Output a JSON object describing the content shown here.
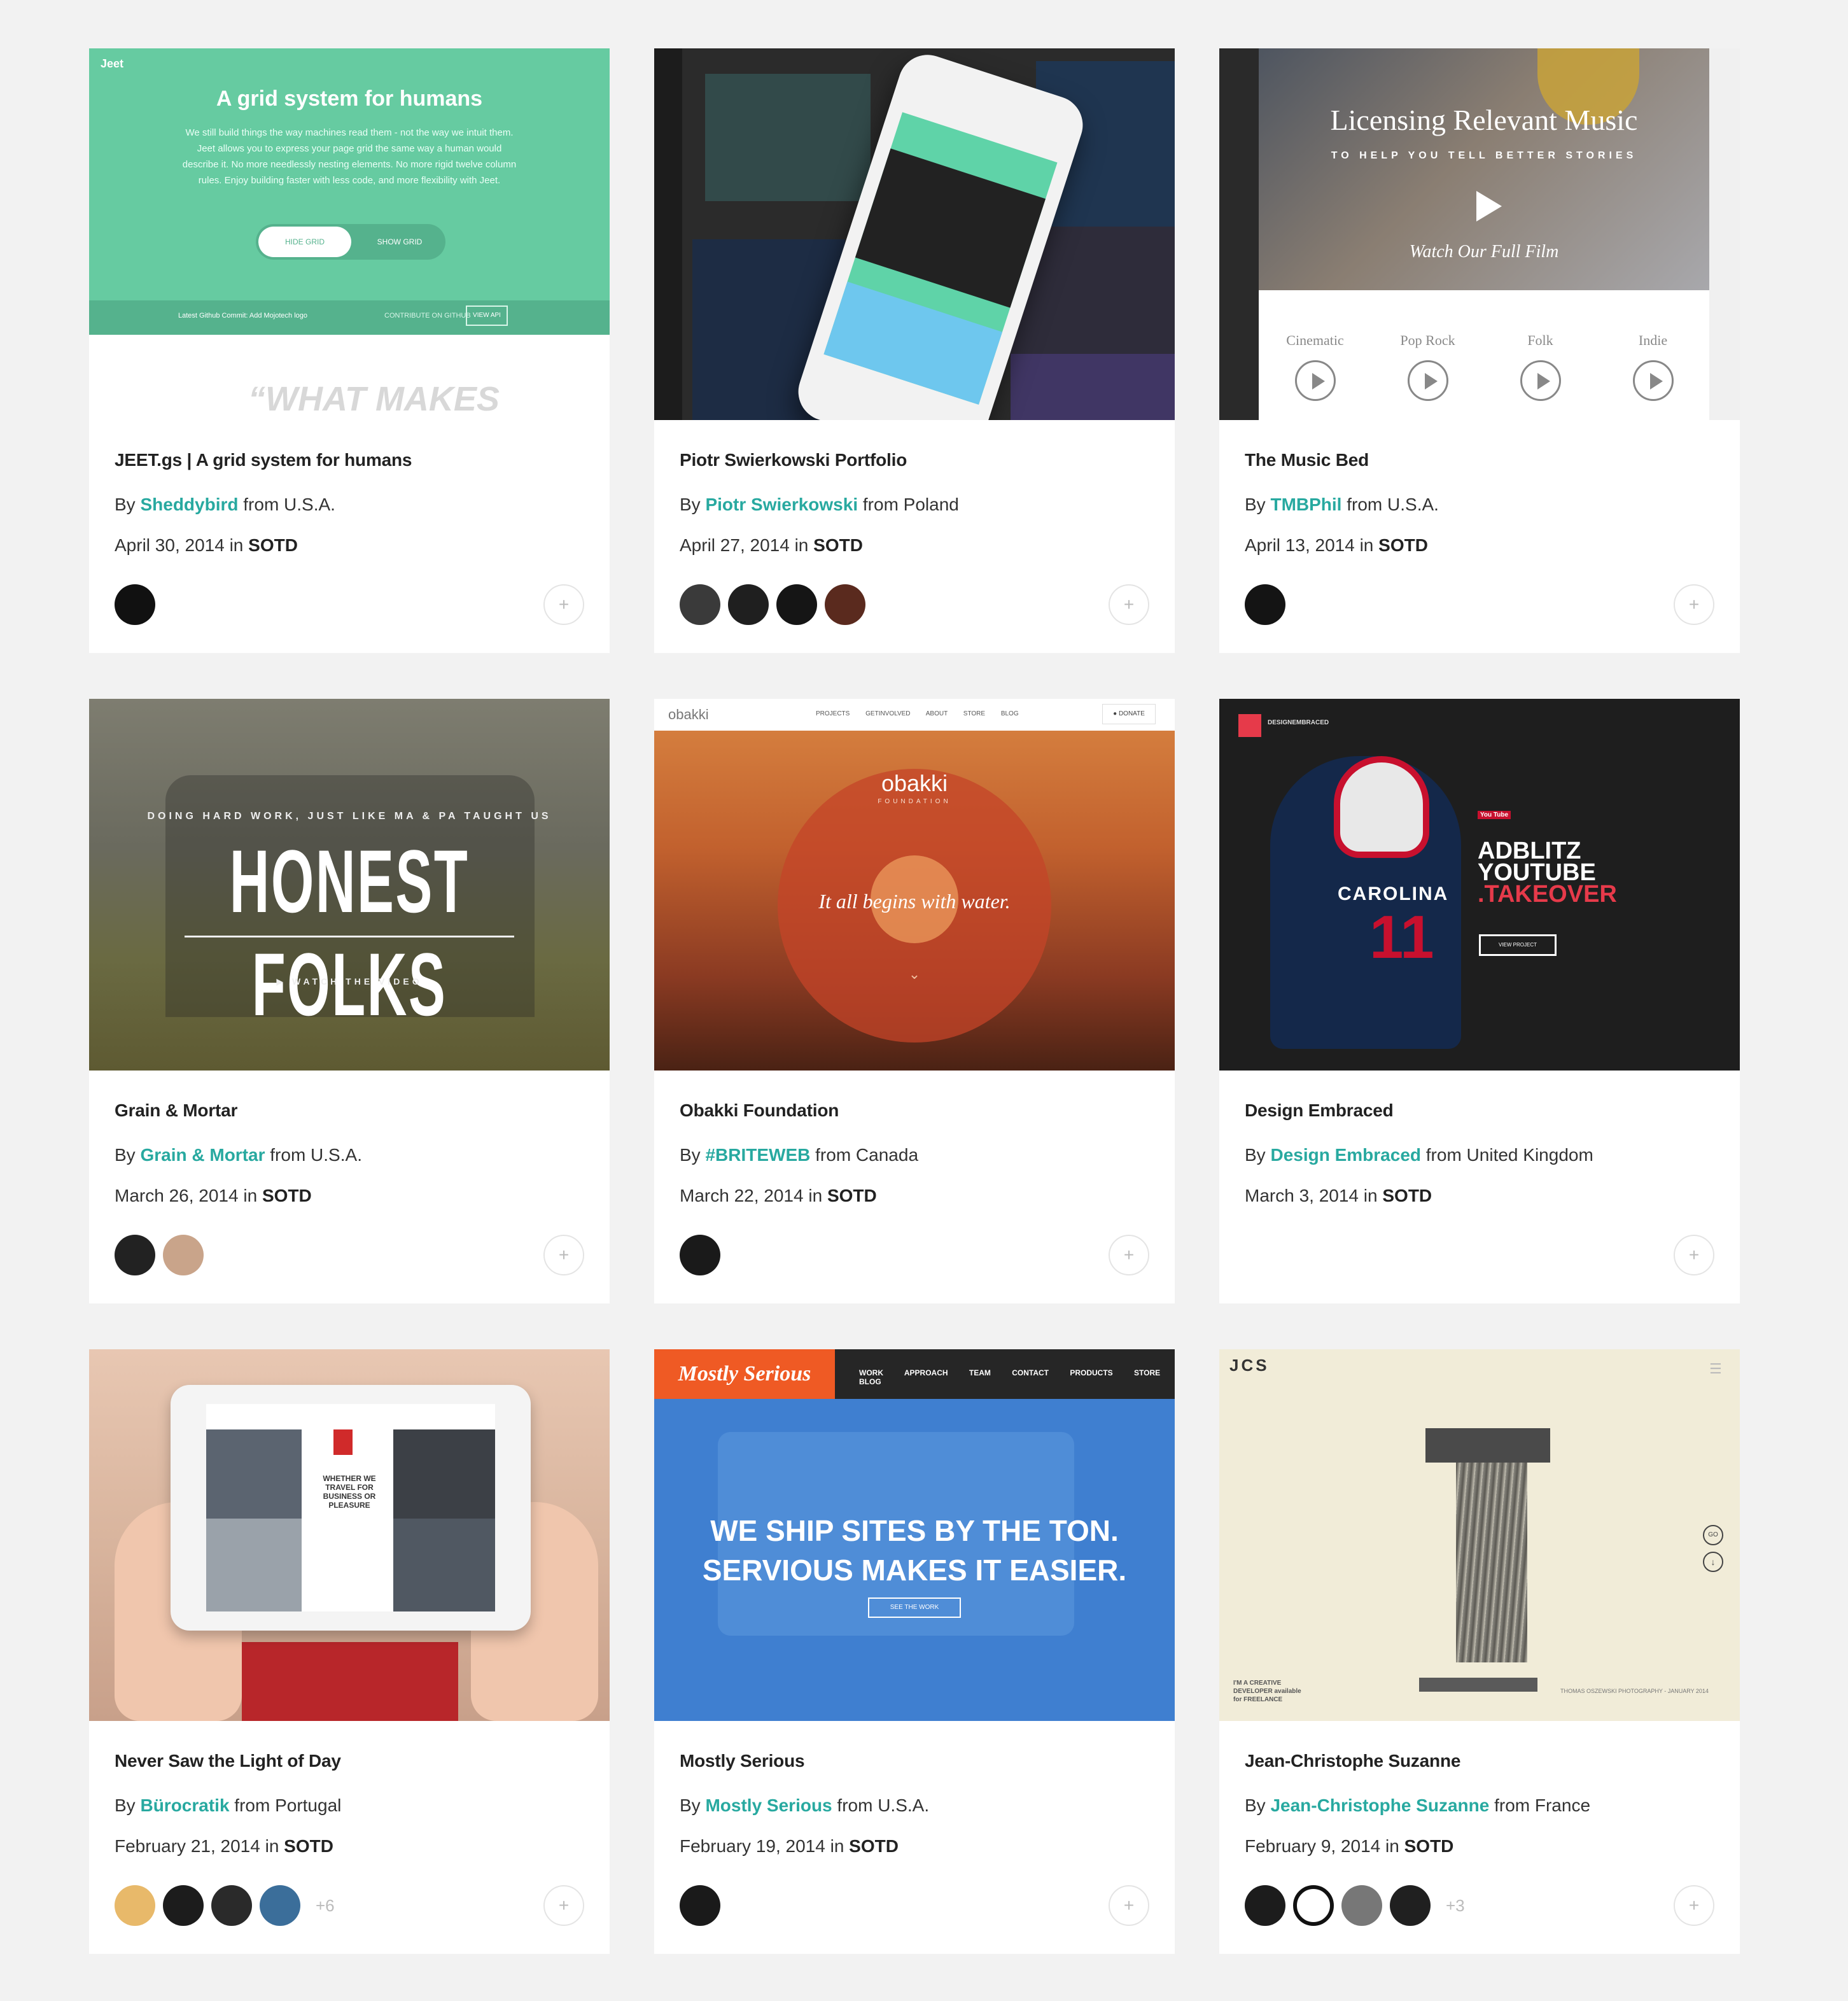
{
  "cards": [
    {
      "title": "JEET.gs | A grid system for humans",
      "by_prefix": "By",
      "author": "Sheddybird",
      "from": "from U.S.A.",
      "date": "April 30, 2014",
      "in_word": "in",
      "category": "SOTD",
      "avatars": [
        "#111111"
      ],
      "more": "",
      "thumb": {
        "logo": "Jeet",
        "heading": "A grid system for humans",
        "body": "We still build things the way machines read them - not the way we intuit them. Jeet allows you to express your page grid the same way a human would describe it. No more needlessly nesting elements. No more rigid twelve column rules. Enjoy building faster with less code, and more flexibility with Jeet.",
        "hide_grid": "HIDE GRID",
        "show_grid": "SHOW GRID",
        "commit": "Latest Github Commit: Add Mojotech logo",
        "contribute": "CONTRIBUTE ON GITHUB",
        "view_api": "VIEW API",
        "quote": "“WHAT MAKES"
      }
    },
    {
      "title": "Piotr Swierkowski Portfolio",
      "by_prefix": "By",
      "author": "Piotr Swierkowski",
      "from": "from Poland",
      "date": "April 27, 2014",
      "in_word": "in",
      "category": "SOTD",
      "avatars": [
        "#3a3a3a",
        "#1f1f1f",
        "#151515",
        "#5a2a1e"
      ],
      "more": ""
    },
    {
      "title": "The Music Bed",
      "by_prefix": "By",
      "author": "TMBPhil",
      "from": "from U.S.A.",
      "date": "April 13, 2014",
      "in_word": "in",
      "category": "SOTD",
      "avatars": [
        "#141414"
      ],
      "more": "",
      "thumb": {
        "heading": "Licensing Relevant Music",
        "sub": "TO HELP YOU TELL BETTER STORIES",
        "film": "Watch Our Full Film",
        "genres": [
          "Cinematic",
          "Pop Rock",
          "Folk",
          "Indie"
        ]
      }
    },
    {
      "title": "Grain & Mortar",
      "by_prefix": "By",
      "author": "Grain & Mortar",
      "from": "from U.S.A.",
      "date": "March 26, 2014",
      "in_word": "in",
      "category": "SOTD",
      "avatars": [
        "#222222",
        "#c9a48a"
      ],
      "more": "",
      "thumb": {
        "tag": "DOING HARD WORK, JUST LIKE MA & PA TAUGHT US",
        "big": "HONEST FOLKS",
        "watch": "▶ WATCH THE VIDEO"
      }
    },
    {
      "title": "Obakki Foundation",
      "by_prefix": "By",
      "author": "#BRITEWEB",
      "from": "from Canada",
      "date": "March 22, 2014",
      "in_word": "in",
      "category": "SOTD",
      "avatars": [
        "#1a1a1a"
      ],
      "more": "",
      "thumb": {
        "logo": "obakki",
        "nav": "PROJECTS GETINVOLVED ABOUT STORE BLOG",
        "donate": "● DONATE",
        "name": "obakki",
        "foundation": "FOUNDATION",
        "tagline": "It all begins with water.",
        "chevron": "⌄"
      }
    },
    {
      "title": "Design Embraced",
      "by_prefix": "By",
      "author": "Design Embraced",
      "from": "from United Kingdom",
      "date": "March 3, 2014",
      "in_word": "in",
      "category": "SOTD",
      "avatars": [],
      "more": "",
      "thumb": {
        "logo_text": "DESIGNEMBRACED",
        "team": "CAROLINA",
        "number": "11",
        "yt": "You Tube",
        "ad1": "ADBLITZ",
        "ad2": "YOUTUBE",
        "ad3": ".TAKEOVER",
        "btn": "VIEW PROJECT"
      }
    },
    {
      "title": "Never Saw the Light of Day",
      "by_prefix": "By",
      "author": "Bürocratik",
      "from": "from Portugal",
      "date": "February 21, 2014",
      "in_word": "in",
      "category": "SOTD",
      "avatars": [
        "#e8b96a",
        "#1c1c1c",
        "#2a2a2a",
        "#3b6e9a"
      ],
      "more": "+6",
      "thumb": {
        "text": "WHETHER WE TRAVEL FOR BUSINESS OR PLEASURE"
      }
    },
    {
      "title": "Mostly Serious",
      "by_prefix": "By",
      "author": "Mostly Serious",
      "from": "from U.S.A.",
      "date": "February 19, 2014",
      "in_word": "in",
      "category": "SOTD",
      "avatars": [
        "#1a1a1a"
      ],
      "more": "",
      "thumb": {
        "logo": "Mostly Serious",
        "nav": "WORK APPROACH TEAM CONTACT PRODUCTS STORE BLOG",
        "line1": "WE SHIP SITES BY THE TON.",
        "line2": "SERVIOUS MAKES IT EASIER.",
        "btn": "SEE THE WORK"
      }
    },
    {
      "title": "Jean-Christophe Suzanne",
      "by_prefix": "By",
      "author": "Jean-Christophe Suzanne",
      "from": "from France",
      "date": "February 9, 2014",
      "in_word": "in",
      "category": "SOTD",
      "avatars": [
        "#1c1c1c",
        "#ffffff",
        "#777777",
        "#202020"
      ],
      "more": "+3",
      "thumb": {
        "logo": "JCS",
        "go": "GO",
        "creative1": "I'M A CREATIVE",
        "creative2": "DEVELOPER available",
        "creative3": "for FREELANCE",
        "credit": "THOMAS OSZEWSKI PHOTOGRAPHY - JANUARY 2014"
      }
    }
  ],
  "ui": {
    "plus": "+"
  },
  "colors": {
    "accent": "#28a9a0",
    "background": "#f2f2f2"
  }
}
